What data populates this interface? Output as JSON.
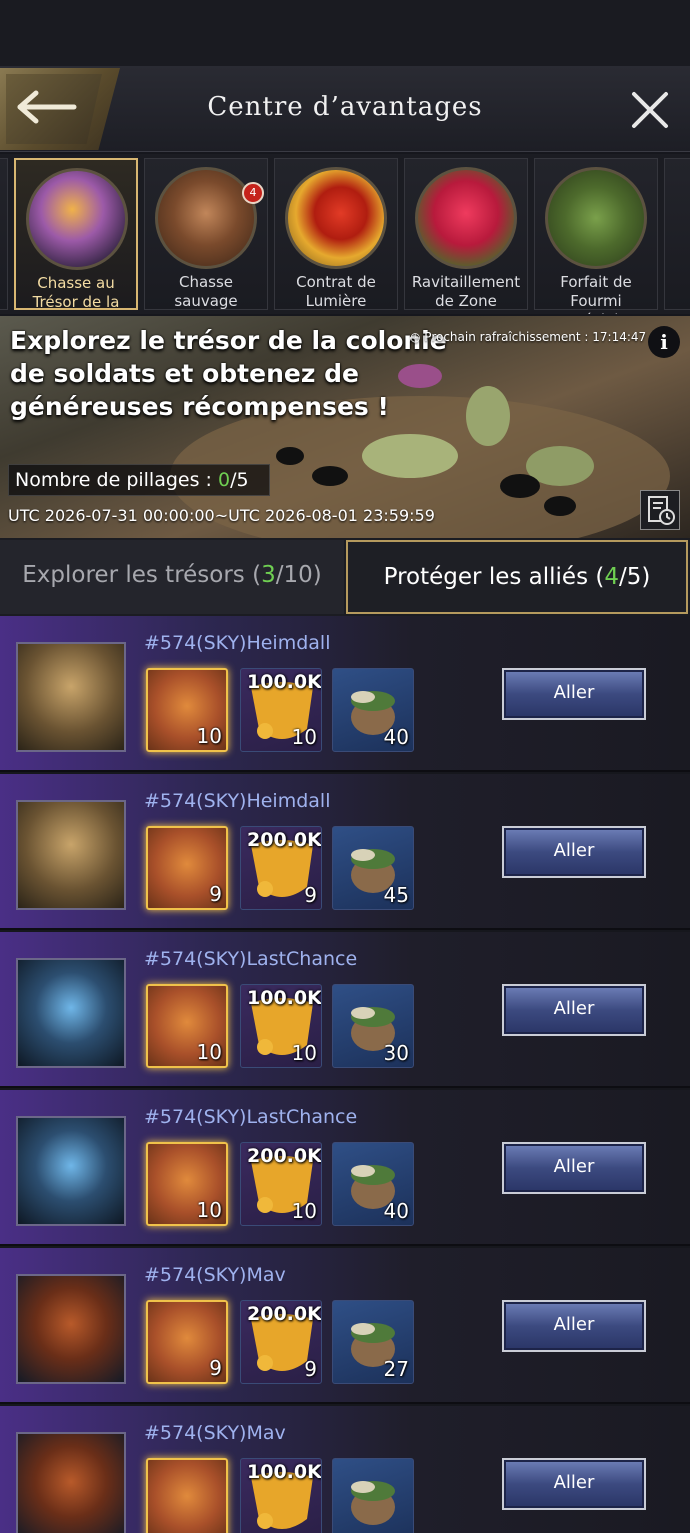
{
  "header": {
    "title": "Centre d’avantages"
  },
  "categories": [
    {
      "label": "Chasse au Trésor de la Colonie",
      "active": true
    },
    {
      "label": "Chasse sauvage",
      "badge": "4"
    },
    {
      "label": "Contrat de Lumière"
    },
    {
      "label": "Ravitaillement de Zone"
    },
    {
      "label": "Forfait de Fourmi Spéciale"
    }
  ],
  "banner": {
    "title": "Explorez le trésor de la colonie de soldats et obtenez de généreuses récompenses !",
    "refresh": "Prochain rafraîchissement : 17:14:47",
    "pillage_label": "Nombre de pillages : ",
    "pillage_current": "0",
    "pillage_max": "/5",
    "utc_range": "UTC 2026-07-31 00:00:00~UTC 2026-08-01 23:59:59"
  },
  "tabs": {
    "explore_label": "Explorer les trésors (",
    "explore_current": "3",
    "explore_rest": "/10)",
    "protect_label": "Protéger les alliés (",
    "protect_current": "4",
    "protect_rest": "/5)"
  },
  "rows": [
    {
      "name": "#574(SKY)Heimdall",
      "r1": "10",
      "amount": "100.0K",
      "r2": "10",
      "r3": "40",
      "button": "Aller"
    },
    {
      "name": "#574(SKY)Heimdall",
      "r1": "9",
      "amount": "200.0K",
      "r2": "9",
      "r3": "45",
      "button": "Aller"
    },
    {
      "name": "#574(SKY)LastChance",
      "r1": "10",
      "amount": "100.0K",
      "r2": "10",
      "r3": "30",
      "button": "Aller"
    },
    {
      "name": "#574(SKY)LastChance",
      "r1": "10",
      "amount": "200.0K",
      "r2": "10",
      "r3": "40",
      "button": "Aller"
    },
    {
      "name": "#574(SKY)Mav",
      "r1": "9",
      "amount": "200.0K",
      "r2": "9",
      "r3": "27",
      "button": "Aller"
    },
    {
      "name": "#574(SKY)Mav",
      "r1": "",
      "amount": "100.0K",
      "r2": "",
      "r3": "",
      "button": "Aller"
    }
  ],
  "colors": {
    "accent_gold": "#d8b772",
    "count_green": "#6fcf52",
    "name_blue": "#9fb2ee"
  }
}
